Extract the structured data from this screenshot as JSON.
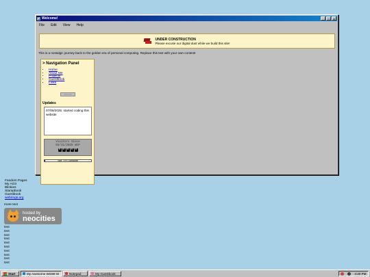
{
  "window": {
    "title": "Welcome!",
    "buttons": {
      "minimize": "_",
      "maximize": "□",
      "close": "x"
    },
    "menu": [
      "File",
      "Edit",
      "View",
      "Help"
    ]
  },
  "banner": {
    "title": "UNDER CONSTRUCTION",
    "subtitle": "Please excuse our digital dust while we build this site!"
  },
  "intro_text": "This is a nostalgic journey back to the golden era of personal computing. Replace this text with your own content!",
  "nav": {
    "title": "> Navigation Panel",
    "links": [
      "Home",
      "About Me",
      "Projects",
      "Guestbook",
      "Links"
    ],
    "arrows": "<<< >>>"
  },
  "updates": {
    "title": "Updates",
    "entries": [
      "07/08/2025: started coding this website"
    ]
  },
  "visitor_counter": {
    "line1": "Visitors Since",
    "line2": "03/31/2025 WIP",
    "digits": [
      "0",
      "0",
      "0",
      "0",
      "0"
    ]
  },
  "progress": {
    "label": "Site: 1% Complete",
    "value_percent": 1
  },
  "desktop_links": [
    "Fandom Pages",
    "My AO3",
    "Blinkies",
    "Stampbook",
    "Guestbook"
  ],
  "desktop_link_special": "webrings.org",
  "more_text": "more text",
  "neocities_badge": {
    "line1": "hosted by",
    "line2": "neocities"
  },
  "text_lines": [
    "text",
    "text",
    "text",
    "text",
    "text",
    "text",
    "text",
    "text",
    "text",
    "text"
  ],
  "taskbar": {
    "start_label": "Start",
    "tasks": [
      {
        "label": "My Awesome Win98 W",
        "active": true
      },
      {
        "label": "Notepad",
        "active": false
      },
      {
        "label": "My Guestbook",
        "active": false
      }
    ],
    "clock": "4:20 PM"
  },
  "colors": {
    "desktop": "#a8d0e6",
    "titlebar_start": "#0a0a7a",
    "titlebar_end": "#1084d0",
    "panel_bg": "#fdf5c9",
    "link": "#0000cc"
  }
}
